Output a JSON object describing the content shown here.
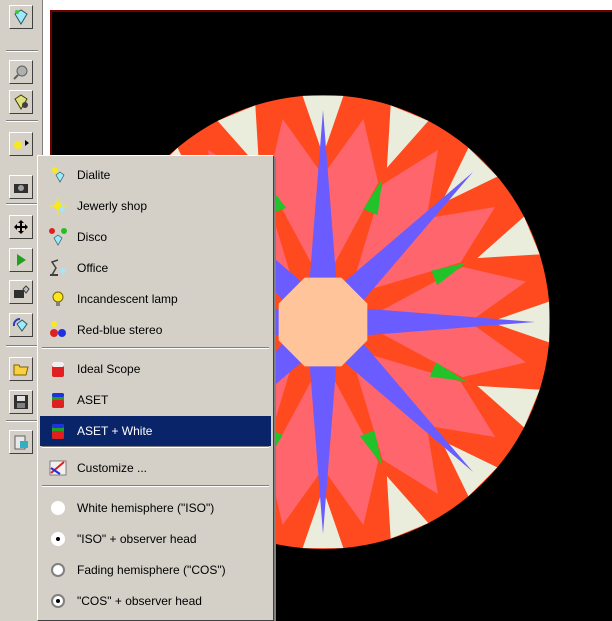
{
  "menu": {
    "items": [
      {
        "label": "Dialite",
        "icon": "lamp-blue-icon"
      },
      {
        "label": "Jewerly shop",
        "icon": "sparkle-light-icon"
      },
      {
        "label": "Disco",
        "icon": "disco-lights-icon"
      },
      {
        "label": "Office",
        "icon": "desk-lamp-icon"
      },
      {
        "label": "Incandescent lamp",
        "icon": "light-bulb-icon"
      },
      {
        "label": "Red-blue stereo",
        "icon": "stereo-glasses-icon"
      },
      {
        "label": "Ideal Scope",
        "icon": "ideal-scope-icon"
      },
      {
        "label": "ASET",
        "icon": "aset-icon"
      },
      {
        "label": "ASET + White",
        "icon": "aset-white-icon",
        "selected": true
      },
      {
        "label": "Customize ...",
        "icon": "customize-icon"
      },
      {
        "label": "White hemisphere (\"ISO\")",
        "icon": "radio-plain"
      },
      {
        "label": "\"ISO\" + observer head",
        "icon": "radio-dot"
      },
      {
        "label": "Fading hemisphere (\"COS\")",
        "icon": "radio-ring"
      },
      {
        "label": "\"COS\" + observer head",
        "icon": "radio-ring-dot"
      }
    ]
  },
  "toolbar": {
    "buttons": [
      "diamond-light-icon",
      "magnifier-icon",
      "diamond-gear-icon",
      "lamp-dropdown-icon",
      "camera-icon",
      "move-icon",
      "play-icon",
      "camera-diamond-icon",
      "rotate-diamond-icon",
      "open-folder-icon",
      "save-icon",
      "printer-icon"
    ]
  },
  "colors": {
    "menu_bg": "#d4d0c8",
    "selection": "#0a246a",
    "viewport_bg": "#000000",
    "gem_red": "#ff4a1f",
    "gem_pink": "#ff6a7a",
    "gem_blue": "#6a5cff",
    "gem_center": "#ffc49a",
    "gem_green": "#22c22a",
    "gem_white": "#e8fff0"
  }
}
